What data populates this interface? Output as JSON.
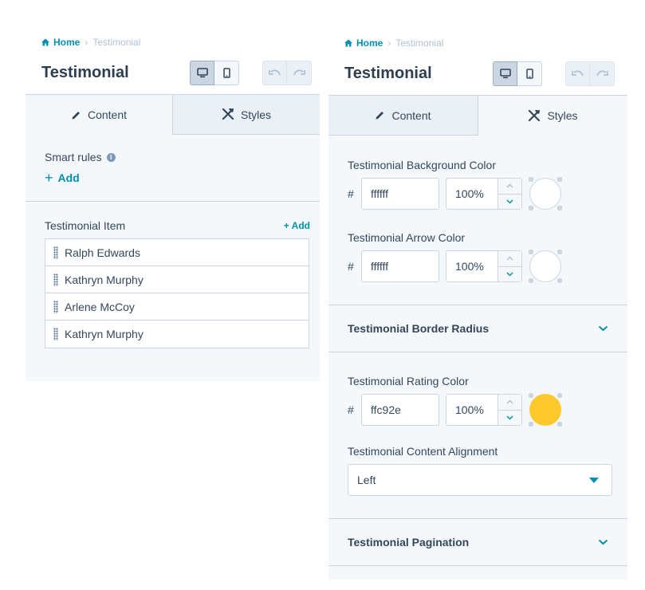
{
  "left_panel": {
    "breadcrumb": {
      "home": "Home",
      "current": "Testimonial"
    },
    "title": "Testimonial",
    "tabs": [
      {
        "label": "Content",
        "icon": "pencil-icon",
        "active": true
      },
      {
        "label": "Styles",
        "icon": "styles-icon",
        "active": false
      }
    ],
    "smart_rules": {
      "label": "Smart rules",
      "add_label": "Add"
    },
    "items": {
      "label": "Testimonial Item",
      "add_label": "+ Add",
      "list": [
        "Ralph Edwards",
        "Kathryn Murphy",
        "Arlene McCoy",
        "Kathryn Murphy"
      ]
    }
  },
  "right_panel": {
    "breadcrumb": {
      "home": "Home",
      "current": "Testimonial"
    },
    "title": "Testimonial",
    "tabs": [
      {
        "label": "Content",
        "icon": "pencil-icon",
        "active": false
      },
      {
        "label": "Styles",
        "icon": "styles-icon",
        "active": true
      }
    ],
    "bg_color": {
      "label": "Testimonial Background Color",
      "hash": "#",
      "hex": "ffffff",
      "opacity": "100%",
      "swatch": "#ffffff"
    },
    "arrow_color": {
      "label": "Testimonial Arrow Color",
      "hash": "#",
      "hex": "ffffff",
      "opacity": "100%",
      "swatch": "#ffffff"
    },
    "border_radius": {
      "label": "Testimonial Border Radius"
    },
    "rating_color": {
      "label": "Testimonial Rating Color",
      "hash": "#",
      "hex": "ffc92e",
      "opacity": "100%",
      "swatch": "#ffc92e"
    },
    "alignment": {
      "label": "Testimonial Content Alignment",
      "value": "Left"
    },
    "pagination": {
      "label": "Testimonial Pagination"
    }
  },
  "colors": {
    "accent": "#0091ae",
    "text": "#33475b",
    "border": "#cbd6e2",
    "panel_bg": "#f5f8fa"
  }
}
